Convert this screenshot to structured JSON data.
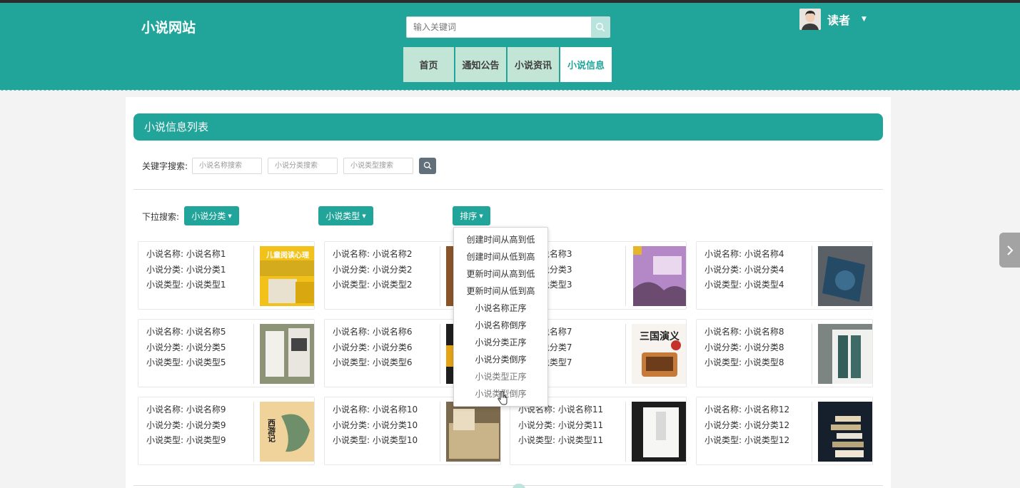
{
  "header": {
    "site_title": "小说网站",
    "search_placeholder": "输入关键词",
    "nav": [
      {
        "label": "首页",
        "active": false
      },
      {
        "label": "通知公告",
        "active": false
      },
      {
        "label": "小说资讯",
        "active": false
      },
      {
        "label": "小说信息",
        "active": true
      }
    ],
    "user_name": "读者"
  },
  "panel": {
    "title": "小说信息列表",
    "keyword_label": "关键字搜索:",
    "keyword_placeholders": [
      "小说名称搜索",
      "小说分类搜索",
      "小说类型搜索"
    ],
    "dropdown_label": "下拉搜索:",
    "dropdown_buttons": [
      "小说分类",
      "小说类型",
      "排序"
    ],
    "sort_options": [
      "创建时间从高到低",
      "创建时间从低到高",
      "更新时间从高到低",
      "更新时间从低到高",
      "小说名称正序",
      "小说名称倒序",
      "小说分类正序",
      "小说分类倒序",
      "小说类型正序",
      "小说类型倒序"
    ]
  },
  "cards": [
    {
      "name": "小说名称: 小说名称1",
      "category": "小说分类: 小说分类1",
      "type": "小说类型: 小说类型1"
    },
    {
      "name": "小说名称: 小说名称2",
      "category": "小说分类: 小说分类2",
      "type": "小说类型: 小说类型2"
    },
    {
      "name": "称: 小说名称3",
      "category": "类: 小说分类3",
      "type": "型: 小说类型3"
    },
    {
      "name": "小说名称: 小说名称4",
      "category": "小说分类: 小说分类4",
      "type": "小说类型: 小说类型4"
    },
    {
      "name": "小说名称: 小说名称5",
      "category": "小说分类: 小说分类5",
      "type": "小说类型: 小说类型5"
    },
    {
      "name": "小说名称: 小说名称6",
      "category": "小说分类: 小说分类6",
      "type": "小说类型: 小说类型6"
    },
    {
      "name": "称: 小说名称7",
      "category": "类: 小说分类7",
      "type": "型: 小说类型7"
    },
    {
      "name": "小说名称: 小说名称8",
      "category": "小说分类: 小说分类8",
      "type": "小说类型: 小说类型8"
    },
    {
      "name": "小说名称: 小说名称9",
      "category": "小说分类: 小说分类9",
      "type": "小说类型: 小说类型9"
    },
    {
      "name": "小说名称: 小说名称10",
      "category": "小说分类: 小说分类10",
      "type": "小说类型: 小说类型10"
    },
    {
      "name": "小说名称: 小说名称11",
      "category": "小说分类: 小说分类11",
      "type": "小说类型: 小说类型11"
    },
    {
      "name": "小说名称: 小说名称12",
      "category": "小说分类: 小说分类12",
      "type": "小说类型: 小说类型12"
    }
  ],
  "cover_texts": {
    "c1": "儿童阅读心理",
    "c7": "三国演义",
    "c9": "西游记"
  },
  "colors": {
    "primary": "#21a49a",
    "nav_inactive": "#c3e5d6",
    "nav_active_text": "#21a49a"
  }
}
